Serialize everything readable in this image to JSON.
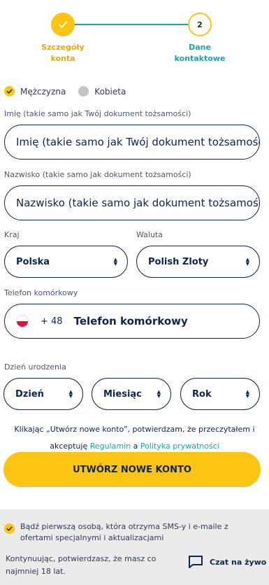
{
  "stepper": {
    "step1": {
      "label_line1": "Szczegóły",
      "label_line2": "konta",
      "state": "done"
    },
    "step2": {
      "number": "2",
      "label_line1": "Dane",
      "label_line2": "kontaktowe",
      "state": "current"
    }
  },
  "gender": {
    "options": [
      {
        "label": "Mężczyzna",
        "selected": true
      },
      {
        "label": "Kobieta",
        "selected": false
      }
    ]
  },
  "first_name": {
    "label": "Imię (takie samo jak Twój dokument tożsamości)",
    "placeholder": "Imię  (takie samo jak Twój dokument tożsamości)"
  },
  "last_name": {
    "label": "Nazwisko (takie samo jak dokument tożsamości)",
    "placeholder": "Nazwisko (takie samo jak dokument tożsamości)"
  },
  "country": {
    "label": "Kraj",
    "value": "Polska"
  },
  "currency": {
    "label": "Waluta",
    "value": "Polish Zloty"
  },
  "phone": {
    "label": "Telefon komórkowy",
    "prefix": "+ 48",
    "placeholder": "Telefon komórkowy",
    "flag_icon": "poland-flag-icon"
  },
  "birthdate": {
    "label": "Dzień urodzenia",
    "day": "Dzień",
    "month": "Miesiąc",
    "year": "Rok"
  },
  "terms": {
    "line1": "Klikając „Utwórz nowe konto”, potwierdzam, że przeczytałem i",
    "line2_prefix": "akceptuję ",
    "regulations_link": "Regulamin",
    "and": " a ",
    "privacy_link": "Polityka prywatności"
  },
  "create_button": {
    "label": "UTWÓRZ NOWE KONTO"
  },
  "marketing": {
    "checked": true,
    "text": "Bądź pierwszą osobą, która otrzyma SMS-y i e-maile z ofertami specjalnymi i aktualizacjami"
  },
  "age_notice": "Kontynuując, potwierdzasz, że masz co najmniej 18 lat.",
  "chat": {
    "label": "Czat na żywo",
    "icon": "chat-bubble-icon"
  },
  "colors": {
    "accent_yellow": "#fdc513",
    "accent_teal": "#14a8a8",
    "navy": "#0d2552",
    "panel_gray": "#ebebeb"
  }
}
